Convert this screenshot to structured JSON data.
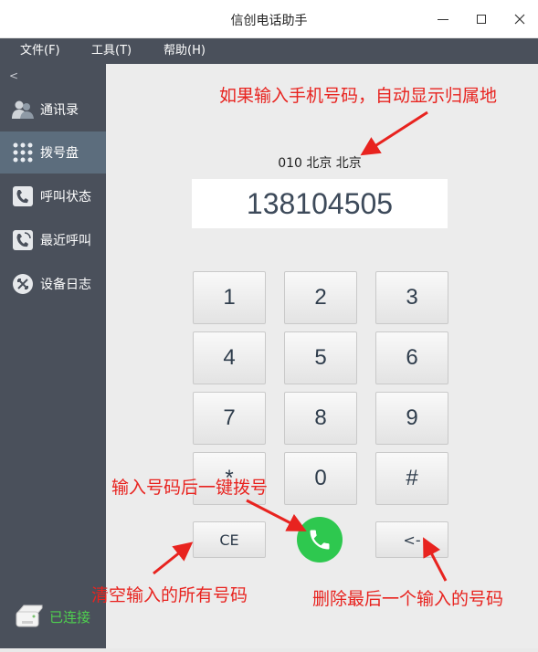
{
  "window": {
    "title": "信创电话助手"
  },
  "menu": {
    "file": "文件(F)",
    "tools": "工具(T)",
    "help": "帮助(H)"
  },
  "sidebar": {
    "collapse_label": "<",
    "items": [
      {
        "label": "通讯录",
        "icon": "contacts-icon"
      },
      {
        "label": "拨号盘",
        "icon": "dialpad-icon",
        "active": true
      },
      {
        "label": "呼叫状态",
        "icon": "call-status-icon"
      },
      {
        "label": "最近呼叫",
        "icon": "recent-calls-icon"
      },
      {
        "label": "设备日志",
        "icon": "device-log-icon"
      }
    ],
    "connection": "已连接"
  },
  "dialer": {
    "location": "010 北京 北京",
    "number": "138104505",
    "keys": [
      "1",
      "2",
      "3",
      "4",
      "5",
      "6",
      "7",
      "8",
      "9",
      "*",
      "0",
      "#"
    ],
    "clear_label": "CE",
    "backspace_label": "<-"
  },
  "annotations": {
    "location_hint": "如果输入手机号码，自动显示归属地",
    "call_hint": "输入号码后一键拨号",
    "clear_hint": "清空输入的所有号码",
    "backspace_hint": "删除最后一个输入的号码"
  },
  "colors": {
    "sidebar": "#4a505b",
    "active": "#5c6d7d",
    "accent_red": "#e8231f",
    "call_green": "#2ec84f",
    "connected": "#4fd14f"
  }
}
